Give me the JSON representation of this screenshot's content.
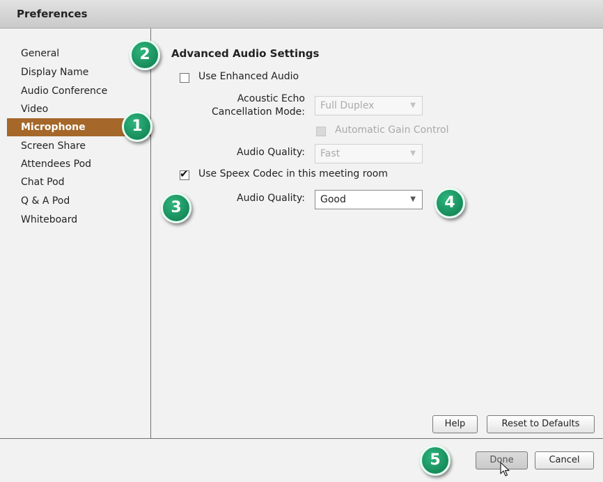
{
  "window": {
    "title": "Preferences"
  },
  "sidebar": {
    "items": [
      {
        "label": "General",
        "selected": false
      },
      {
        "label": "Display Name",
        "selected": false
      },
      {
        "label": "Audio Conference",
        "selected": false
      },
      {
        "label": "Video",
        "selected": false
      },
      {
        "label": "Microphone",
        "selected": true
      },
      {
        "label": "Screen Share",
        "selected": false
      },
      {
        "label": "Attendees Pod",
        "selected": false
      },
      {
        "label": "Chat Pod",
        "selected": false
      },
      {
        "label": "Q & A Pod",
        "selected": false
      },
      {
        "label": "Whiteboard",
        "selected": false
      }
    ],
    "selected_color": "#a5672a"
  },
  "advanced_audio": {
    "title": "Advanced Audio Settings",
    "enhanced_audio": {
      "label": "Use Enhanced Audio",
      "checked": false
    },
    "echo_mode": {
      "label_line1": "Acoustic Echo",
      "label_line2": "Cancellation Mode:",
      "value": "Full Duplex",
      "enabled": false
    },
    "agc": {
      "label": "Automatic Gain Control",
      "checked": false,
      "enabled": false
    },
    "enhanced_quality": {
      "label": "Audio Quality:",
      "value": "Fast",
      "enabled": false
    },
    "speex": {
      "label": "Use Speex Codec in this meeting room",
      "checked": true
    },
    "speex_quality": {
      "label": "Audio Quality:",
      "value": "Good",
      "enabled": true
    }
  },
  "buttons": {
    "help": "Help",
    "reset": "Reset to Defaults",
    "done": "Done",
    "cancel": "Cancel"
  },
  "callouts": [
    "1",
    "2",
    "3",
    "4",
    "5"
  ],
  "callout_color": "#1a9a62",
  "icons": {
    "dropdown": "chevron-down-icon",
    "check": "checkmark-icon",
    "cursor": "mouse-pointer-icon"
  }
}
